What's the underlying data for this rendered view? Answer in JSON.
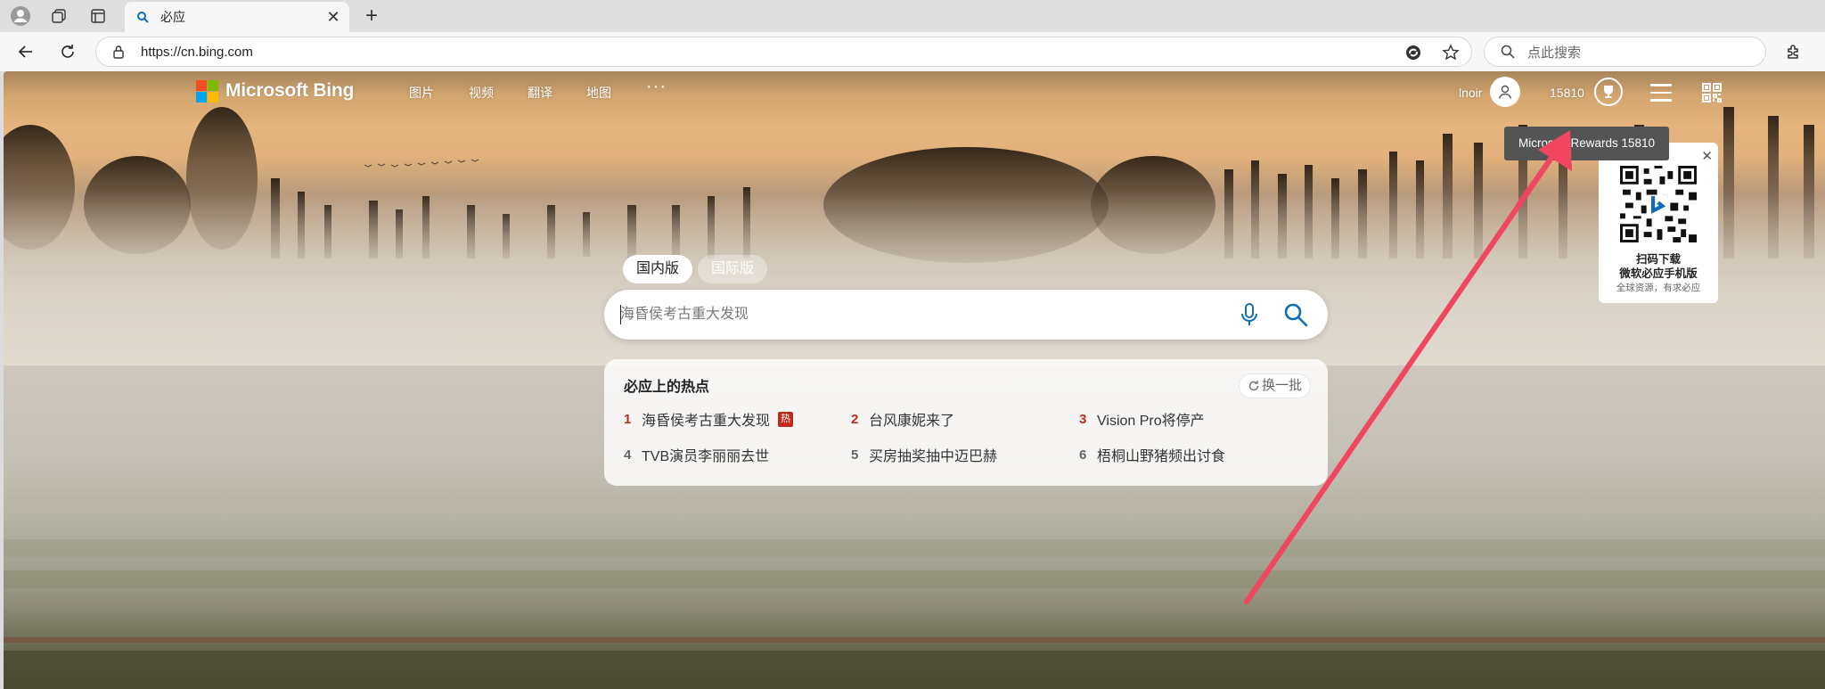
{
  "browser": {
    "tab_title": "必应",
    "url": "https://cn.bing.com",
    "side_search_placeholder": "点此搜索"
  },
  "bing": {
    "logo_text": "Microsoft Bing",
    "logo_colors": [
      "#f25022",
      "#7fba00",
      "#00a4ef",
      "#ffb900"
    ],
    "nav": [
      "图片",
      "视频",
      "翻译",
      "地图"
    ],
    "more": "···",
    "user_name": "lnoir",
    "points": "15810",
    "rewards_tooltip": "Microsoft Rewards 15810",
    "qr_card": {
      "line1": "扫码下载",
      "line2": "微软必应手机版",
      "line3": "全球资源，有求必应"
    },
    "market": {
      "domestic": "国内版",
      "international": "国际版"
    },
    "search_placeholder": "海昏侯考古重大发现",
    "hot": {
      "title": "必应上的热点",
      "refresh": "换一批",
      "badge": "热",
      "items": [
        {
          "rank": "1",
          "text": "海昏侯考古重大发现"
        },
        {
          "rank": "2",
          "text": "台风康妮来了"
        },
        {
          "rank": "3",
          "text": "Vision Pro将停产"
        },
        {
          "rank": "4",
          "text": "TVB演员李丽丽去世"
        },
        {
          "rank": "5",
          "text": "买房抽奖抽中迈巴赫"
        },
        {
          "rank": "6",
          "text": "梧桐山野猪频出讨食"
        }
      ]
    }
  },
  "accent_colors": {
    "annotation_arrow": "#f0465f",
    "hot_red": "#c1291c",
    "bing_blue": "#0f6cbd"
  }
}
